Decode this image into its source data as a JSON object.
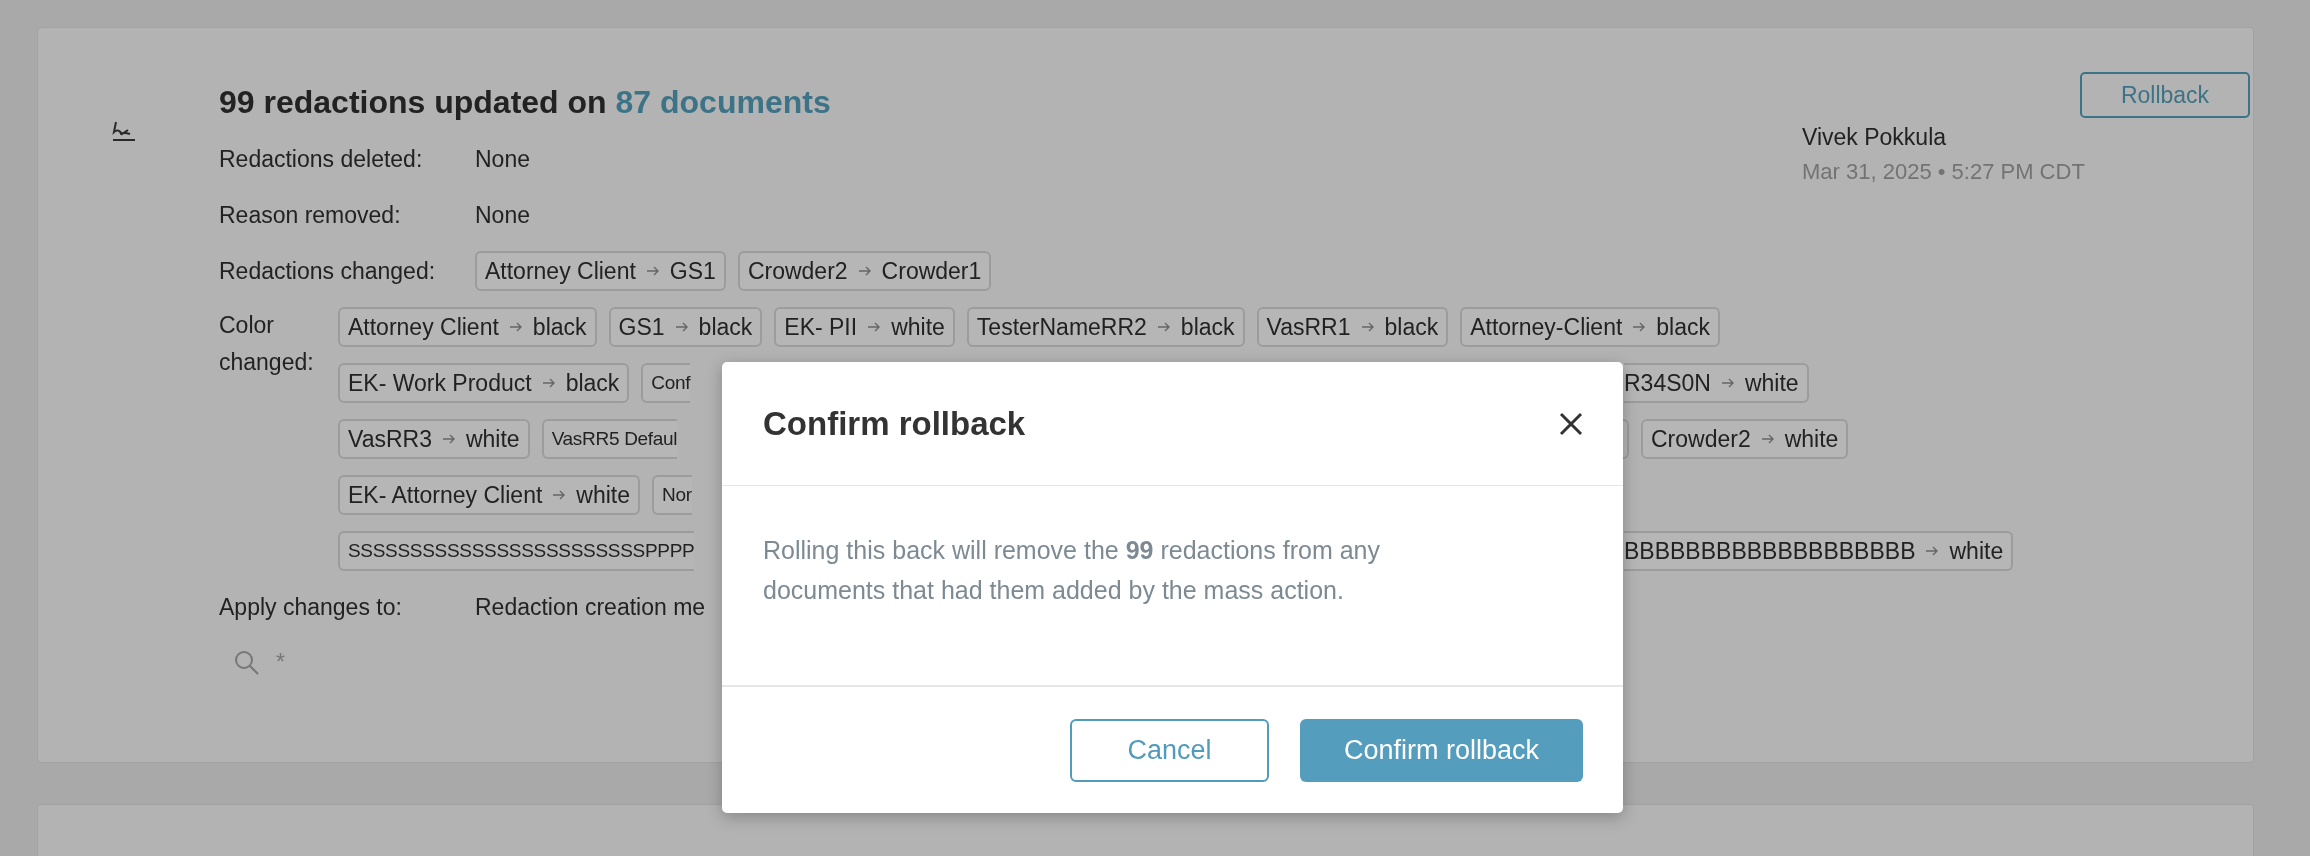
{
  "activity": {
    "title": "99 redactions updated on",
    "link": "87 documents",
    "fields": [
      {
        "label": "Redactions deleted:",
        "value": "None"
      },
      {
        "label": "Reason removed:",
        "value": "None"
      }
    ],
    "redactions_changed": {
      "label": "Redactions changed:",
      "tags": [
        {
          "from": "Attorney Client",
          "to": "GS1"
        },
        {
          "from": "Crowder2",
          "to": "Crowder1"
        }
      ]
    },
    "color_changed": {
      "label": "Color changed:",
      "rows": [
        {
          "left": [
            {
              "kind": "full",
              "from": "Attorney Client",
              "to": "black"
            },
            {
              "kind": "full",
              "from": "GS1",
              "to": "black"
            },
            {
              "kind": "full",
              "from": "EK- PII",
              "to": "white"
            },
            {
              "kind": "full",
              "from": "TesterNameRR2",
              "to": "black"
            },
            {
              "kind": "full",
              "from": "VasRR1",
              "to": "black"
            },
            {
              "kind": "full",
              "from": "Attorney-Client",
              "to": "black"
            }
          ],
          "right": []
        },
        {
          "left": [
            {
              "kind": "full",
              "from": "EK- Work Product",
              "to": "black"
            },
            {
              "kind": "cut_right",
              "from": "Conf"
            }
          ],
          "right": [
            {
              "kind": "cut_left",
              "from": "R34S0N",
              "to": "white"
            }
          ]
        },
        {
          "left": [
            {
              "kind": "full",
              "from": "VasRR3",
              "to": "white"
            },
            {
              "kind": "cut_right",
              "from": "VasRR5 Defaul"
            }
          ],
          "right": [
            {
              "kind": "edge"
            },
            {
              "kind": "full",
              "from": "Crowder2",
              "to": "white"
            }
          ]
        },
        {
          "left": [
            {
              "kind": "full",
              "from": "EK- Attorney Client",
              "to": "white"
            },
            {
              "kind": "cut_right",
              "from": "Nor"
            }
          ],
          "right": []
        },
        {
          "left": [
            {
              "kind": "cut_right",
              "from": "SSSSSSSSSSSSSSSSSSSSSSSSPPPP"
            }
          ],
          "right": [
            {
              "kind": "cut_left",
              "from": "BBBBBBBBBBBBBBBBBBB",
              "to": "white"
            }
          ]
        }
      ]
    },
    "apply": {
      "label": "Apply changes to:",
      "value": "Redaction creation me"
    },
    "search_term": "*",
    "rollback_button": "Rollback",
    "user": "Vivek Pokkula",
    "date": "Mar 31, 2025 • 5:27 PM CDT"
  },
  "dialog": {
    "title": "Confirm rollback",
    "message": "Rolling this back will remove the **99** redactions from any documents that had them added by the mass action.",
    "buttons": [
      {
        "label": "Cancel",
        "kind": "secondary"
      },
      {
        "label": "Confirm rollback",
        "kind": "primary"
      }
    ]
  }
}
